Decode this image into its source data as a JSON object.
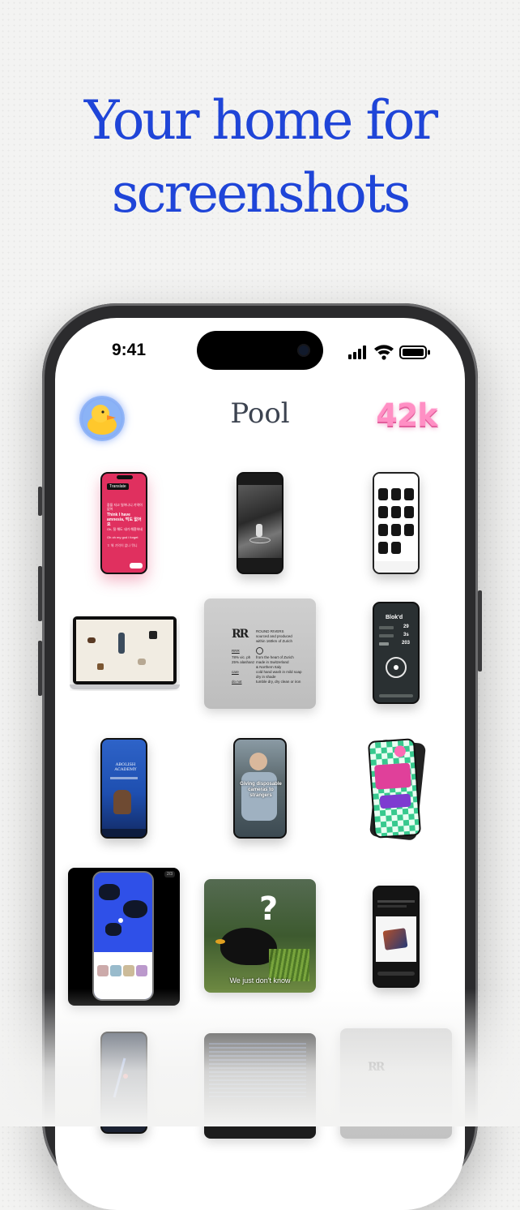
{
  "hero": {
    "line1": "Your home for",
    "line2": "screenshots"
  },
  "status_bar": {
    "time": "9:41"
  },
  "app": {
    "title": "Pool",
    "count_badge": "42k"
  },
  "grid": {
    "korean": {
      "header": "Translate",
      "korean_line1": "잠을 자고 일어나니 기억이 없어",
      "english_line1": "Think I have amnesia, 먹도 없어요",
      "korean_line2": "Oh, 질 해도 내가 해환하네",
      "english_line2": "Oh oh my god i forget",
      "korean_line3": "ㅎ 해 기억이 없나 뭐니"
    },
    "blokd": {
      "title": "Blok'd",
      "stat1": "29",
      "stat2": "3s",
      "stat3": "203"
    },
    "round_rivers": {
      "logo": "RR",
      "line1": "ROUND RIVERS",
      "line2": "sourced and produced",
      "line3": "within 160km of Zurich",
      "row1_left": "RRR",
      "row2_left": "78% vic. ph",
      "row2_right": "from the heart of Zurich",
      "row3_left": "25% alashanz",
      "row3_right": "made in Switzerland",
      "row4_right": "& Northern Italy",
      "row5_left": "care",
      "row5_right": "cold hand wash in mild soap",
      "row6_right": "dry in shade",
      "row7_left": "do not",
      "row7_right": "tumble dry, dry clean or iron"
    },
    "academy": {
      "title": "ABOLISH ACADEMY"
    },
    "disposable": {
      "caption": "Giving disposable cameras to strangers"
    },
    "blackbird": {
      "question": "?",
      "subtitle": "We just don't know"
    },
    "map": {
      "badge": "2/3"
    }
  }
}
